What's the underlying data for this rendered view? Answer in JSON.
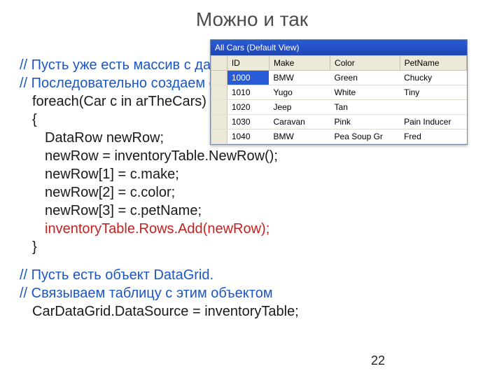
{
  "title": "Можно и так",
  "code": {
    "c1": "// Пусть уже есть массив с данными о машинах.",
    "c2": "// Последовательно создаем строки и включаем их в таблицу.",
    "l1": "foreach(Car c in arTheCars)",
    "l2": "{",
    "l3": "DataRow newRow;",
    "l4": "newRow = inventoryTable.NewRow();",
    "l5": "newRow[1] = c.make;",
    "l6": "newRow[2] = c.color;",
    "l7": "newRow[3] = c.petName;",
    "l8": "inventoryTable.Rows.Add(newRow);",
    "l9": "}",
    "c3": "// Пусть есть объект DataGrid.",
    "c4": "// Связываем таблицу c этим объектом",
    "l10": "CarDataGrid.DataSource = inventoryTable;"
  },
  "grid": {
    "caption": "All Cars (Default View)",
    "headers": {
      "id": "ID",
      "make": "Make",
      "color": "Color",
      "petname": "PetName"
    },
    "rows": [
      {
        "id": "1000",
        "make": "BMW",
        "color": "Green",
        "petname": "Chucky"
      },
      {
        "id": "1010",
        "make": "Yugo",
        "color": "White",
        "petname": "Tiny"
      },
      {
        "id": "1020",
        "make": "Jeep",
        "color": "Tan",
        "petname": ""
      },
      {
        "id": "1030",
        "make": "Caravan",
        "color": "Pink",
        "petname": "Pain Inducer"
      },
      {
        "id": "1040",
        "make": "BMW",
        "color": "Pea Soup Gr",
        "petname": "Fred"
      }
    ]
  },
  "page_number": "22"
}
